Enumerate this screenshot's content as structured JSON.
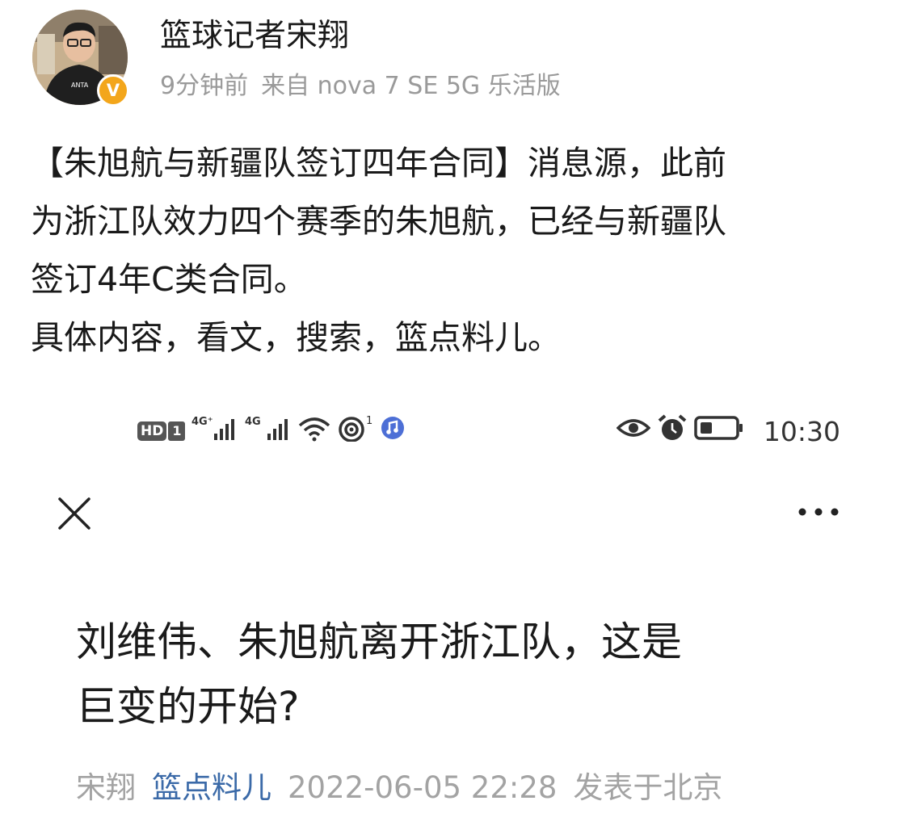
{
  "post": {
    "author": "篮球记者宋翔",
    "time": "9分钟前",
    "device": "来自 nova 7 SE 5G 乐活版",
    "badge": "V",
    "body_lines": [
      "【朱旭航与新疆队签订四年合同】消息源，此前",
      "为浙江队效力四个赛季的朱旭航，已经与新疆队",
      "签订4年C类合同。",
      "具体内容，看文，搜索，篮点料儿。"
    ]
  },
  "phone_screenshot": {
    "status_bar": {
      "hd": "HD",
      "sim": "1",
      "signal_1": "4G⁺",
      "signal_2": "4G",
      "hotspot_count": "1",
      "time": "10:30",
      "icons": [
        "hd-icon",
        "signal-icon",
        "wifi-icon",
        "hotspot-icon",
        "music-icon",
        "eye-icon",
        "alarm-icon",
        "battery-icon"
      ]
    },
    "article": {
      "title_lines": [
        "刘维伟、朱旭航离开浙江队，这是",
        "巨变的开始?"
      ],
      "author": "宋翔",
      "source": "篮点料儿",
      "datetime": "2022-06-05 22:28",
      "location": "发表于北京"
    }
  },
  "colors": {
    "verified": "#f3a61b",
    "source_link": "#3b6aa8",
    "meta_gray": "#9a9a9a"
  }
}
